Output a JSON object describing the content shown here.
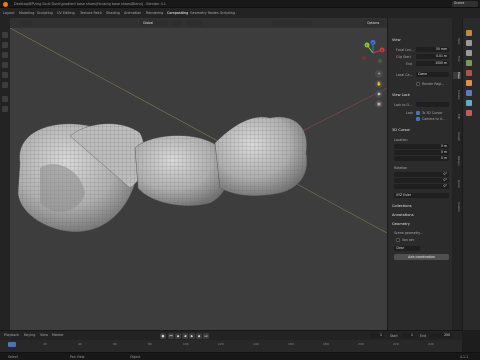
{
  "window": {
    "title": "Desktop\\BP\\ring Scull Dunk\\gradient base shoes\\Housing base shoes\\Blend] - Blender 4.1",
    "scene": "Scene"
  },
  "menus": [
    "Layout",
    "Modeling",
    "Sculpting",
    "UV Editing",
    "Texture Paint",
    "Shading",
    "Animation",
    "Rendering",
    "Compositing",
    "Geometry Nodes",
    "Scripting"
  ],
  "viewport": {
    "orientation": "Global",
    "options": "Options"
  },
  "gizmo": {
    "x": "X",
    "y": "Y",
    "z": "Z"
  },
  "nav_icons": [
    "zoom-icon",
    "hand-icon",
    "camera-icon",
    "grid-icon"
  ],
  "npanel": {
    "view_header": "View",
    "focal_label": "Focal Len...",
    "focal_value": "50 mm",
    "clip_start_label": "Clip Start",
    "clip_start_value": "0.01 m",
    "end_label": "End",
    "end_value": "1000 m",
    "local_camera_label": "Local Ca...",
    "local_camera_value": "Came",
    "render_region": "Render Regi...",
    "view_lock_header": "View Lock",
    "lock_to_object": "Lock to O...",
    "lock_label": "Lock",
    "to_3d_cursor": "To 3D Cursor",
    "camera_to_view": "Camera to V...",
    "cursor_header": "3D Cursor",
    "location_label": "Location",
    "loc_x": "0 m",
    "loc_y": "0 m",
    "loc_z": "0 m",
    "rotation_label": "Rotation",
    "rot_x": "0°",
    "rot_y": "0°",
    "rot_z": "0°",
    "euler": "XYZ Euler",
    "collections": "Collections",
    "annotations": "Annotations",
    "geometry_header": "Geometry",
    "scene_geo_label": "Scene geometry...",
    "merge_label": "Van aer",
    "clear_label": "Clear",
    "apply_label": "Axis coordination"
  },
  "npanel_tabs": [
    "Item",
    "Tool",
    "View",
    "Create",
    "Edit",
    "Sculpt",
    "Retopo",
    "Quick",
    "Scatter"
  ],
  "timeline": {
    "playback": "Playback",
    "keying": "Keying",
    "view": "View",
    "marker": "Marker",
    "start_label": "Start",
    "start": "1",
    "end_label": "End",
    "end": "250",
    "current": "1"
  },
  "ruler": [
    "0",
    "20",
    "40",
    "60",
    "80",
    "100",
    "120",
    "140",
    "160",
    "180",
    "200",
    "220",
    "240"
  ],
  "status": {
    "select": "Select",
    "pan": "Pan View",
    "context": "Object",
    "version": "4.1.1"
  },
  "colors": {
    "accent": "#4772b3",
    "viewport": "#3d3d3d",
    "mesh": "#c8c8c8"
  }
}
